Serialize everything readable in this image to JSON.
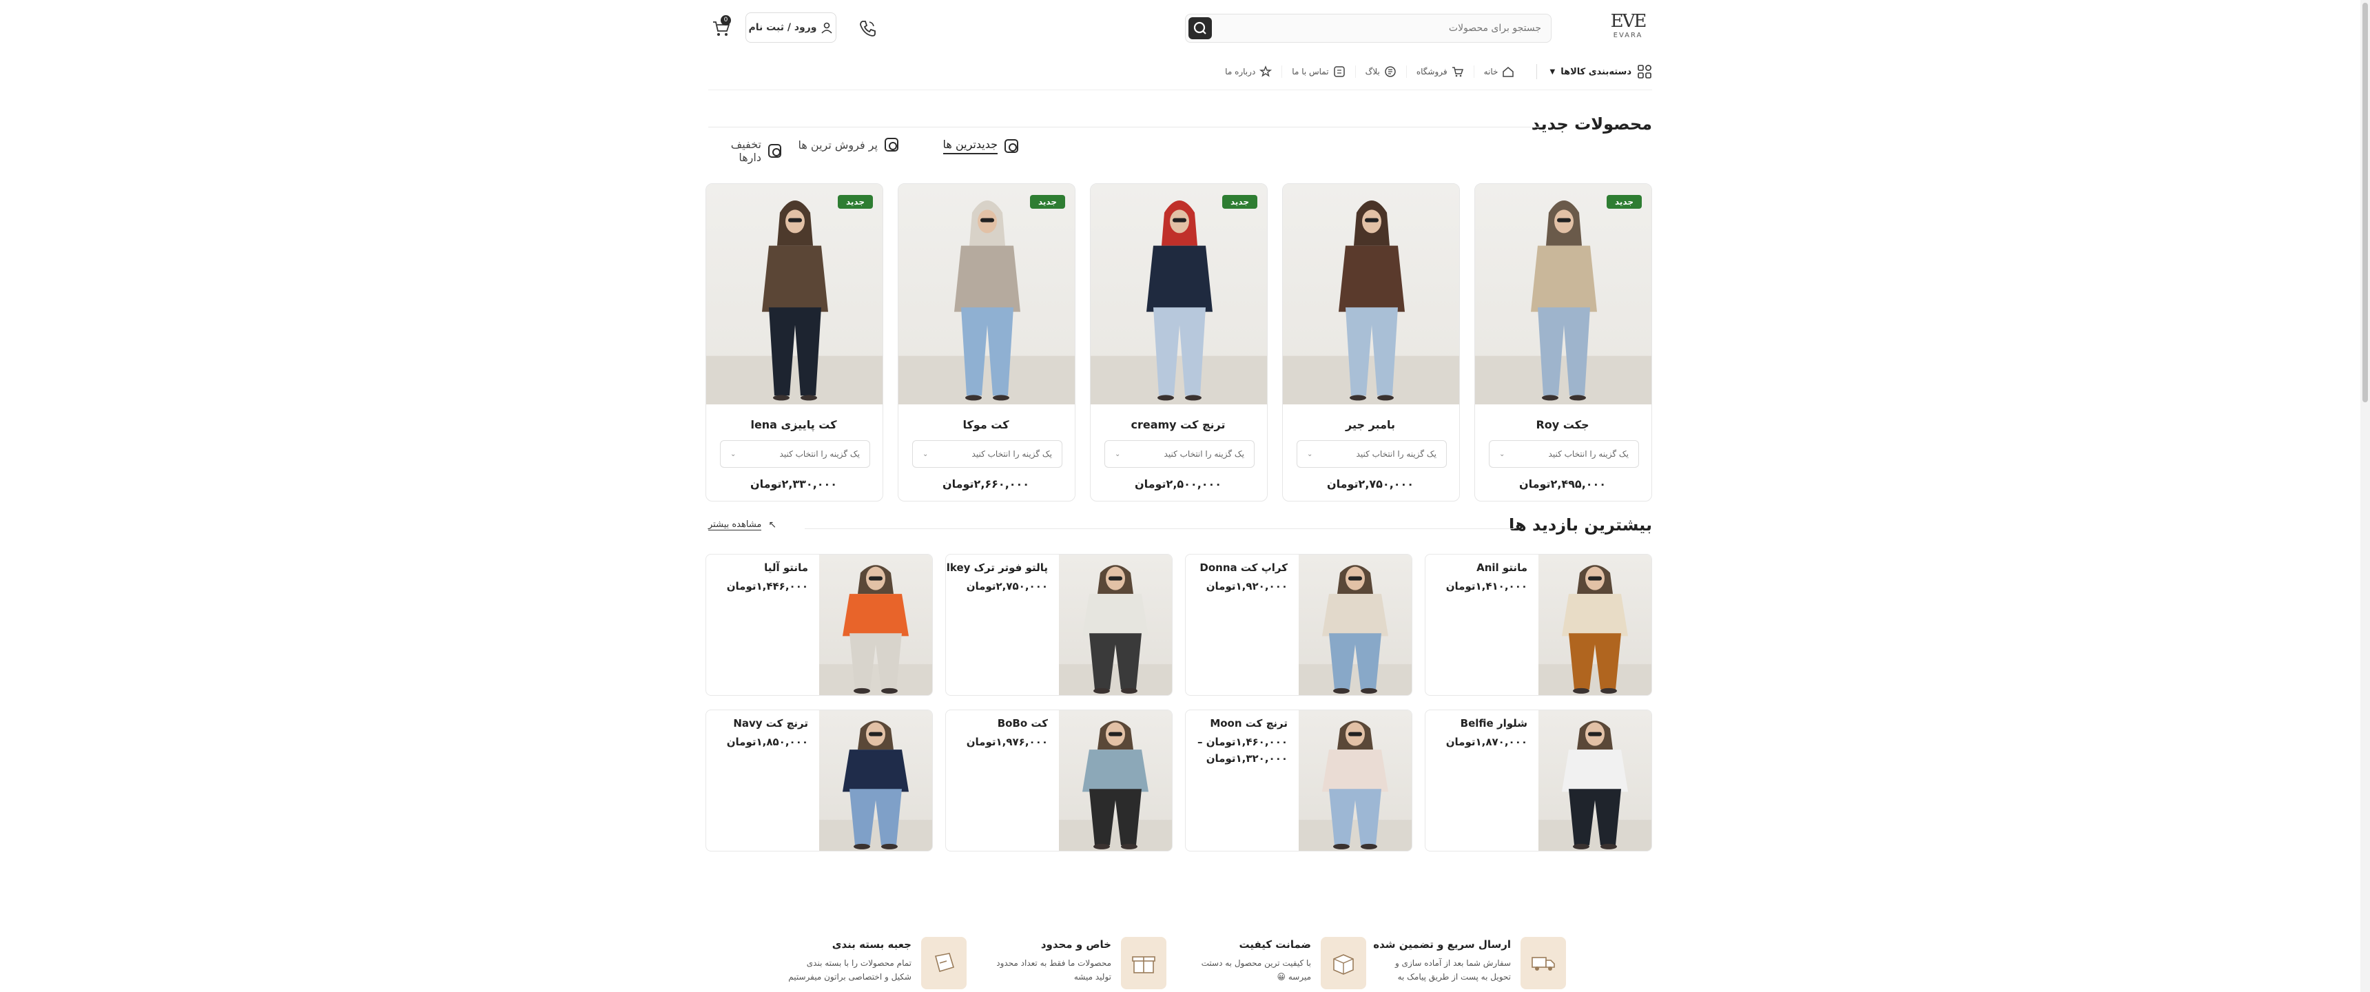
{
  "header": {
    "logo_mark": "EVE",
    "logo_text": "EVARA",
    "search_placeholder": "جستجو برای محصولات",
    "login_label": "ورود / ثبت نام",
    "cart_count": "0"
  },
  "nav": {
    "categories_label": "دسته‌بندی کالاها",
    "items": [
      {
        "label": "خانه",
        "icon": "home-icon"
      },
      {
        "label": "فروشگاه",
        "icon": "cart-icon"
      },
      {
        "label": "بلاگ",
        "icon": "blog-icon"
      },
      {
        "label": "تماس با ما",
        "icon": "contact-icon"
      },
      {
        "label": "درباره ما",
        "icon": "star-icon"
      }
    ]
  },
  "new_products": {
    "title": "محصولات جدید",
    "tabs": [
      {
        "label": "جدیدترین ها",
        "active": true
      },
      {
        "label": "پر فروش ترین ها",
        "active": false
      },
      {
        "label": "تخفیف دارها",
        "active": false
      }
    ],
    "select_placeholder": "یک گزینه را انتخاب کنید",
    "new_tag": "جدید",
    "products": [
      {
        "name": "جکت Roy",
        "price": "۲,۴۹۵,۰۰۰تومان",
        "new": true,
        "coat": "#c9b79a",
        "pants": "#9eb4cc",
        "hair": "#6a5a4a"
      },
      {
        "name": "بامبر جیر",
        "price": "۲,۷۵۰,۰۰۰تومان",
        "new": false,
        "coat": "#5a3a2c",
        "pants": "#a9bfd6",
        "hair": "#4a3428"
      },
      {
        "name": "ترنچ کت creamy",
        "price": "۲,۵۰۰,۰۰۰تومان",
        "new": true,
        "coat": "#1f2a3f",
        "pants": "#b7c8dc",
        "hair": "#c0302a"
      },
      {
        "name": "کت موکا",
        "price": "۲,۶۶۰,۰۰۰تومان",
        "new": true,
        "coat": "#b5aa9e",
        "pants": "#8fb0d2",
        "hair": "#d8d2c8"
      },
      {
        "name": "کت پاییزی lena",
        "price": "۲,۳۳۰,۰۰۰تومان",
        "new": true,
        "coat": "#5b4636",
        "pants": "#1d2430",
        "hair": "#4d3a2c"
      }
    ]
  },
  "most_viewed": {
    "title": "بیشترین بازدید ها",
    "more_label": "مشاهده بیشتر",
    "items": [
      {
        "name": "مانتو Anil",
        "price": "۱,۴۱۰,۰۰۰تومان",
        "coat": "#e8dcc6",
        "pants": "#b0651f"
      },
      {
        "name": "کراپ کت Donna",
        "price": "۱,۹۲۰,۰۰۰تومان",
        "coat": "#e2d9cb",
        "pants": "#88a8c8"
      },
      {
        "name": "پالتو فوتر ترک Milkey",
        "price": "۲,۷۵۰,۰۰۰تومان",
        "coat": "#e6e5df",
        "pants": "#3a3a3a"
      },
      {
        "name": "مانتو آلیا",
        "price": "۱,۴۴۶,۰۰۰تومان",
        "coat": "#e8642a",
        "pants": "#d8d4cc"
      },
      {
        "name": "شلوار Belfie",
        "price": "۱,۸۷۰,۰۰۰تومان",
        "coat": "#f1f1f1",
        "pants": "#1f242c"
      },
      {
        "name": "ترنچ کت Moon",
        "price": "۱,۴۶۰,۰۰۰تومان –",
        "price2": "۱,۳۲۰,۰۰۰تومان",
        "coat": "#eadcd4",
        "pants": "#9db7d4"
      },
      {
        "name": "کت BoBo",
        "price": "۱,۹۷۶,۰۰۰تومان",
        "coat": "#8ca8b8",
        "pants": "#2b2b2b"
      },
      {
        "name": "ترنچ کت Navy",
        "price": "۱,۸۵۰,۰۰۰تومان",
        "coat": "#1f2c4a",
        "pants": "#7fa0c8"
      }
    ]
  },
  "features": [
    {
      "title": "ارسال سریع و تضمین شده",
      "desc": "سفارش شما بعد از آماده سازی و تحویل به پست از طریق پیامک به",
      "icon": "truck-icon"
    },
    {
      "title": "ضمانت کیفیت",
      "desc": "با کیفیت ترین محصول به دستت میرسه 😀",
      "icon": "quality-box-icon"
    },
    {
      "title": "خاص و محدود",
      "desc": "محصولات ما فقط به تعداد محدود تولید میشه",
      "icon": "gift-box-icon"
    },
    {
      "title": "جعبه بسته بندی",
      "desc": "تمام محصولات را با بسته بندی شکیل و اختصاصی براتون میفرستیم",
      "icon": "package-icon"
    }
  ],
  "colors": {
    "accent": "#2b2b2b",
    "new_tag": "#2e7d32",
    "feature_bg": "#f3e6d6"
  }
}
